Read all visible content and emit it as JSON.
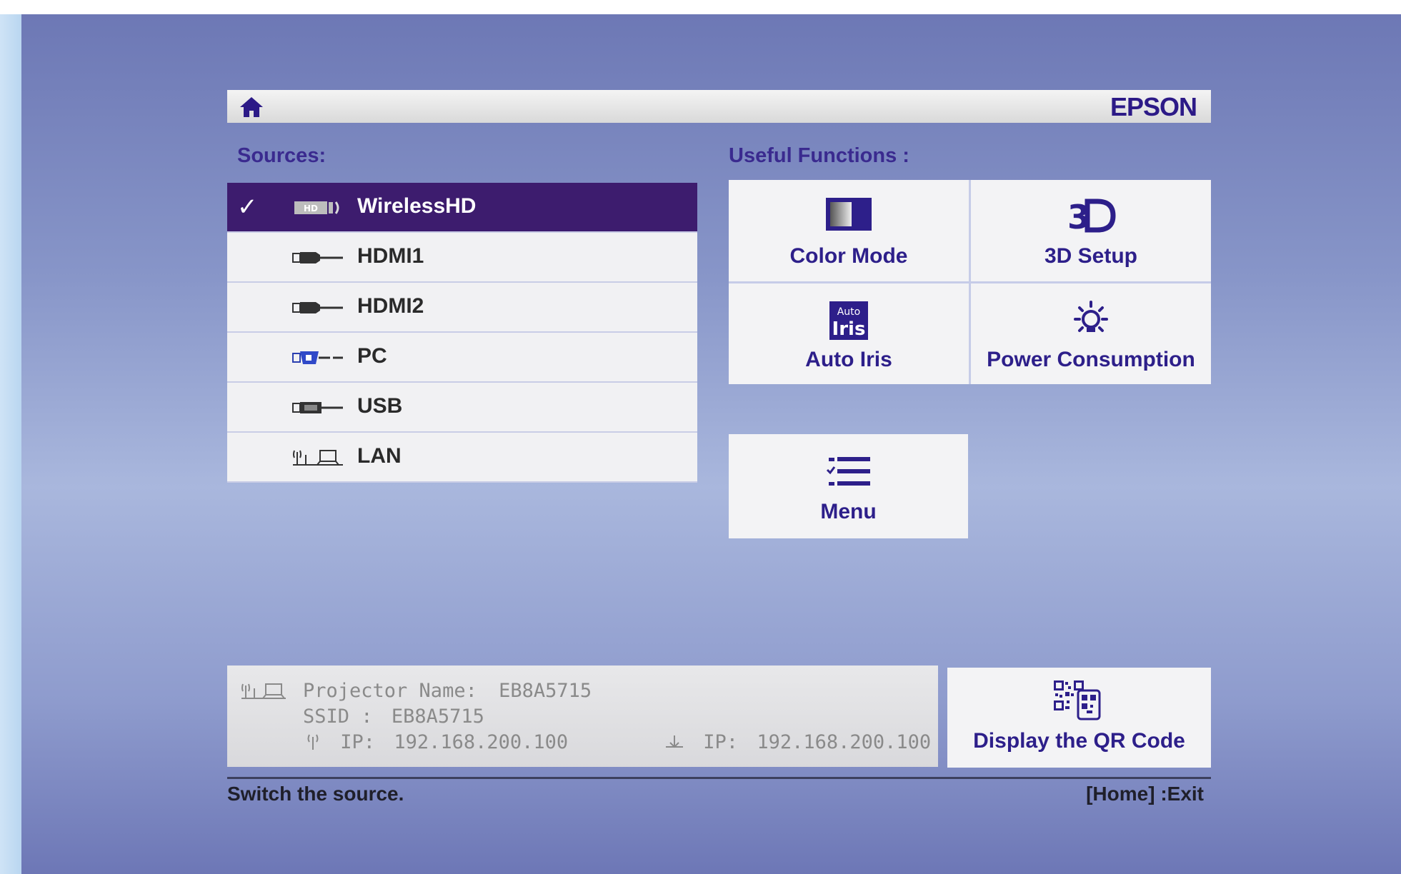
{
  "header": {
    "brand": "EPSON",
    "home_icon": "home-icon"
  },
  "sources": {
    "label": "Sources:",
    "items": [
      {
        "label": "WirelessHD",
        "icon": "wirelesshd-icon",
        "selected": true
      },
      {
        "label": "HDMI1",
        "icon": "hdmi-icon",
        "selected": false
      },
      {
        "label": "HDMI2",
        "icon": "hdmi-icon",
        "selected": false
      },
      {
        "label": "PC",
        "icon": "pc-icon",
        "selected": false
      },
      {
        "label": "USB",
        "icon": "usb-icon",
        "selected": false
      },
      {
        "label": "LAN",
        "icon": "lan-icon",
        "selected": false
      }
    ]
  },
  "functions": {
    "label": "Useful Functions :",
    "items": [
      {
        "label": "Color Mode",
        "icon": "color-mode-icon"
      },
      {
        "label": "3D Setup",
        "icon": "3d-icon"
      },
      {
        "label": "Auto Iris",
        "icon": "auto-iris-icon"
      },
      {
        "label": "Power Consumption",
        "icon": "power-consumption-icon"
      }
    ],
    "menu": {
      "label": "Menu",
      "icon": "menu-list-icon"
    },
    "auto_iris_icon_text": [
      "Auto",
      "Iris"
    ]
  },
  "info": {
    "projector_name_label": "Projector Name:",
    "projector_name": "EB8A5715",
    "ssid_label": "SSID :",
    "ssid": "EB8A5715",
    "wireless_ip_label": "IP:",
    "wireless_ip": "192.168.200.100",
    "wired_ip_label": "IP:",
    "wired_ip": "192.168.200.100"
  },
  "qr": {
    "label": "Display the QR Code",
    "icon": "qr-code-icon"
  },
  "status": {
    "hint": "Switch the source.",
    "exit": "[Home] :Exit"
  },
  "colors": {
    "selected_bg": "#3d1c6e",
    "accent_text": "#2d1f8a",
    "tile_bg": "#f3f3f5"
  }
}
